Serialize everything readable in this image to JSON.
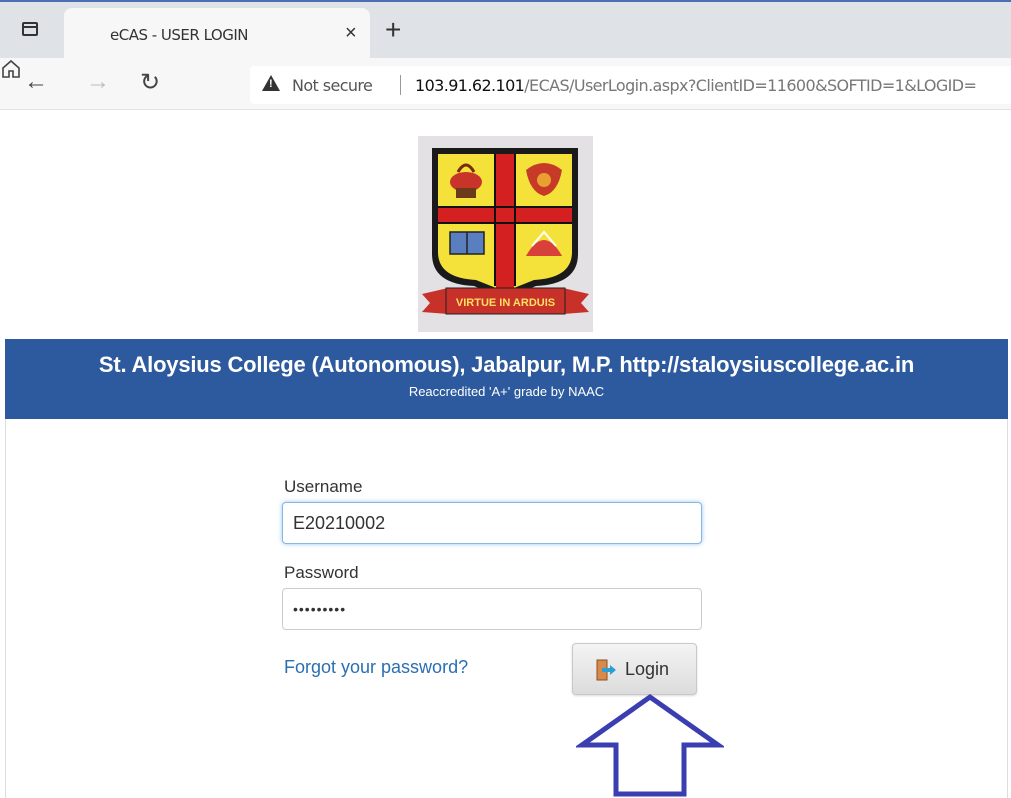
{
  "browser": {
    "tab_title": "eCAS - USER LOGIN",
    "tab_close": "×",
    "new_tab": "+",
    "security_label": "Not secure",
    "url_host": "103.91.62.101",
    "url_path": "/ECAS/UserLogin.aspx?ClientID=11600&SOFTID=1&LOGID="
  },
  "college": {
    "logo_motto": "VIRTUE IN ARDUIS",
    "title": "St. Aloysius College (Autonomous), Jabalpur, M.P. http://staloysiuscollege.ac.in",
    "subtitle": "Reaccredited 'A+' grade by NAAC",
    "brand_color": "#2d5a9e"
  },
  "login_form": {
    "username_label": "Username",
    "username_value": "E20210002",
    "password_label": "Password",
    "password_value": "123456789",
    "forgot_link": "Forgot your password?",
    "login_button": "Login"
  },
  "icons": {
    "window": "window-icon",
    "back": "arrow-left-icon",
    "forward": "arrow-right-icon",
    "reload": "reload-icon",
    "home": "home-icon",
    "warning": "warning-icon",
    "login": "login-door-icon",
    "annotation": "up-arrow-icon"
  },
  "annotation_color": "#3a3eb0"
}
